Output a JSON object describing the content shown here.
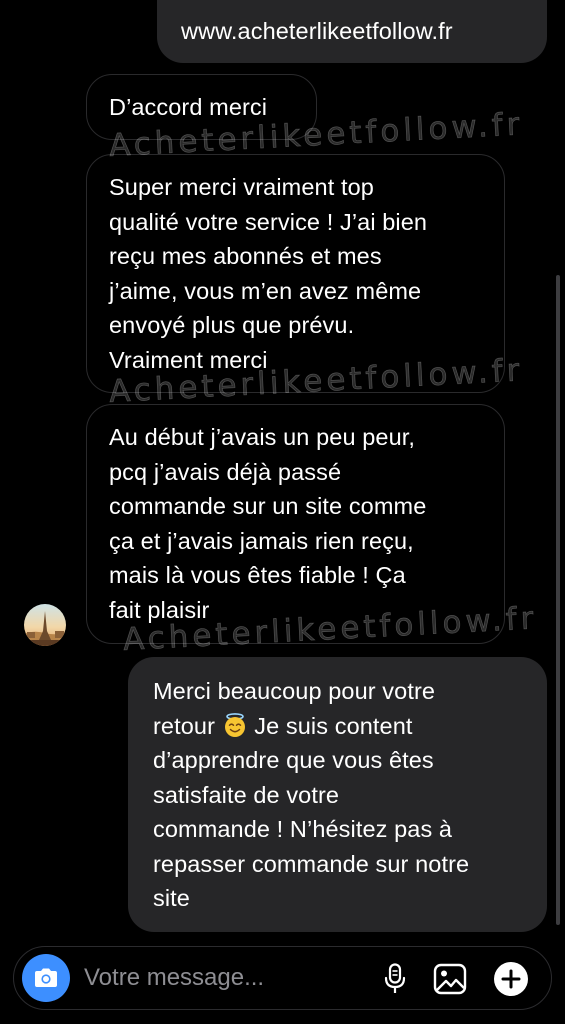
{
  "conversation": {
    "messages": [
      {
        "direction": "outgoing",
        "text": "www.acheterlikeetfollow.fr"
      },
      {
        "direction": "incoming",
        "text": "D’accord merci"
      },
      {
        "direction": "incoming",
        "text": "Super merci vraiment top\nqualité votre service ! J’ai bien\nreçu mes abonnés et mes\nj’aime, vous m’en avez même\nenvoyé plus que prévu.\nVraiment merci"
      },
      {
        "direction": "incoming",
        "text": "Au début j’avais un peu peur,\npcq j’avais déjà passé\ncommande sur un site comme\nça et j’avais jamais rien reçu,\nmais là vous êtes fiable ! Ça\nfait plaisir"
      },
      {
        "direction": "outgoing",
        "text_before_emoji": "Merci beaucoup pour votre\nretour ",
        "emoji": "smiling-face-with-halo",
        "text_after_emoji": " Je suis content\nd’apprendre que vous êtes\nsatisfaite de votre\ncommande ! N’hésitez pas à\nrepasser commande sur notre\nsite"
      }
    ],
    "watermark": "Acheterlikeetfollow.fr"
  },
  "composer": {
    "placeholder": "Votre message...",
    "value": "",
    "icons": {
      "camera": "camera-icon",
      "mic": "microphone-icon",
      "gallery": "gallery-icon",
      "more": "plus-icon"
    },
    "camera_color": "#3d8fff"
  },
  "colors": {
    "background": "#000000",
    "outgoing_bubble": "#262628",
    "incoming_border": "#2a2a2c",
    "placeholder": "#8e8e93"
  }
}
